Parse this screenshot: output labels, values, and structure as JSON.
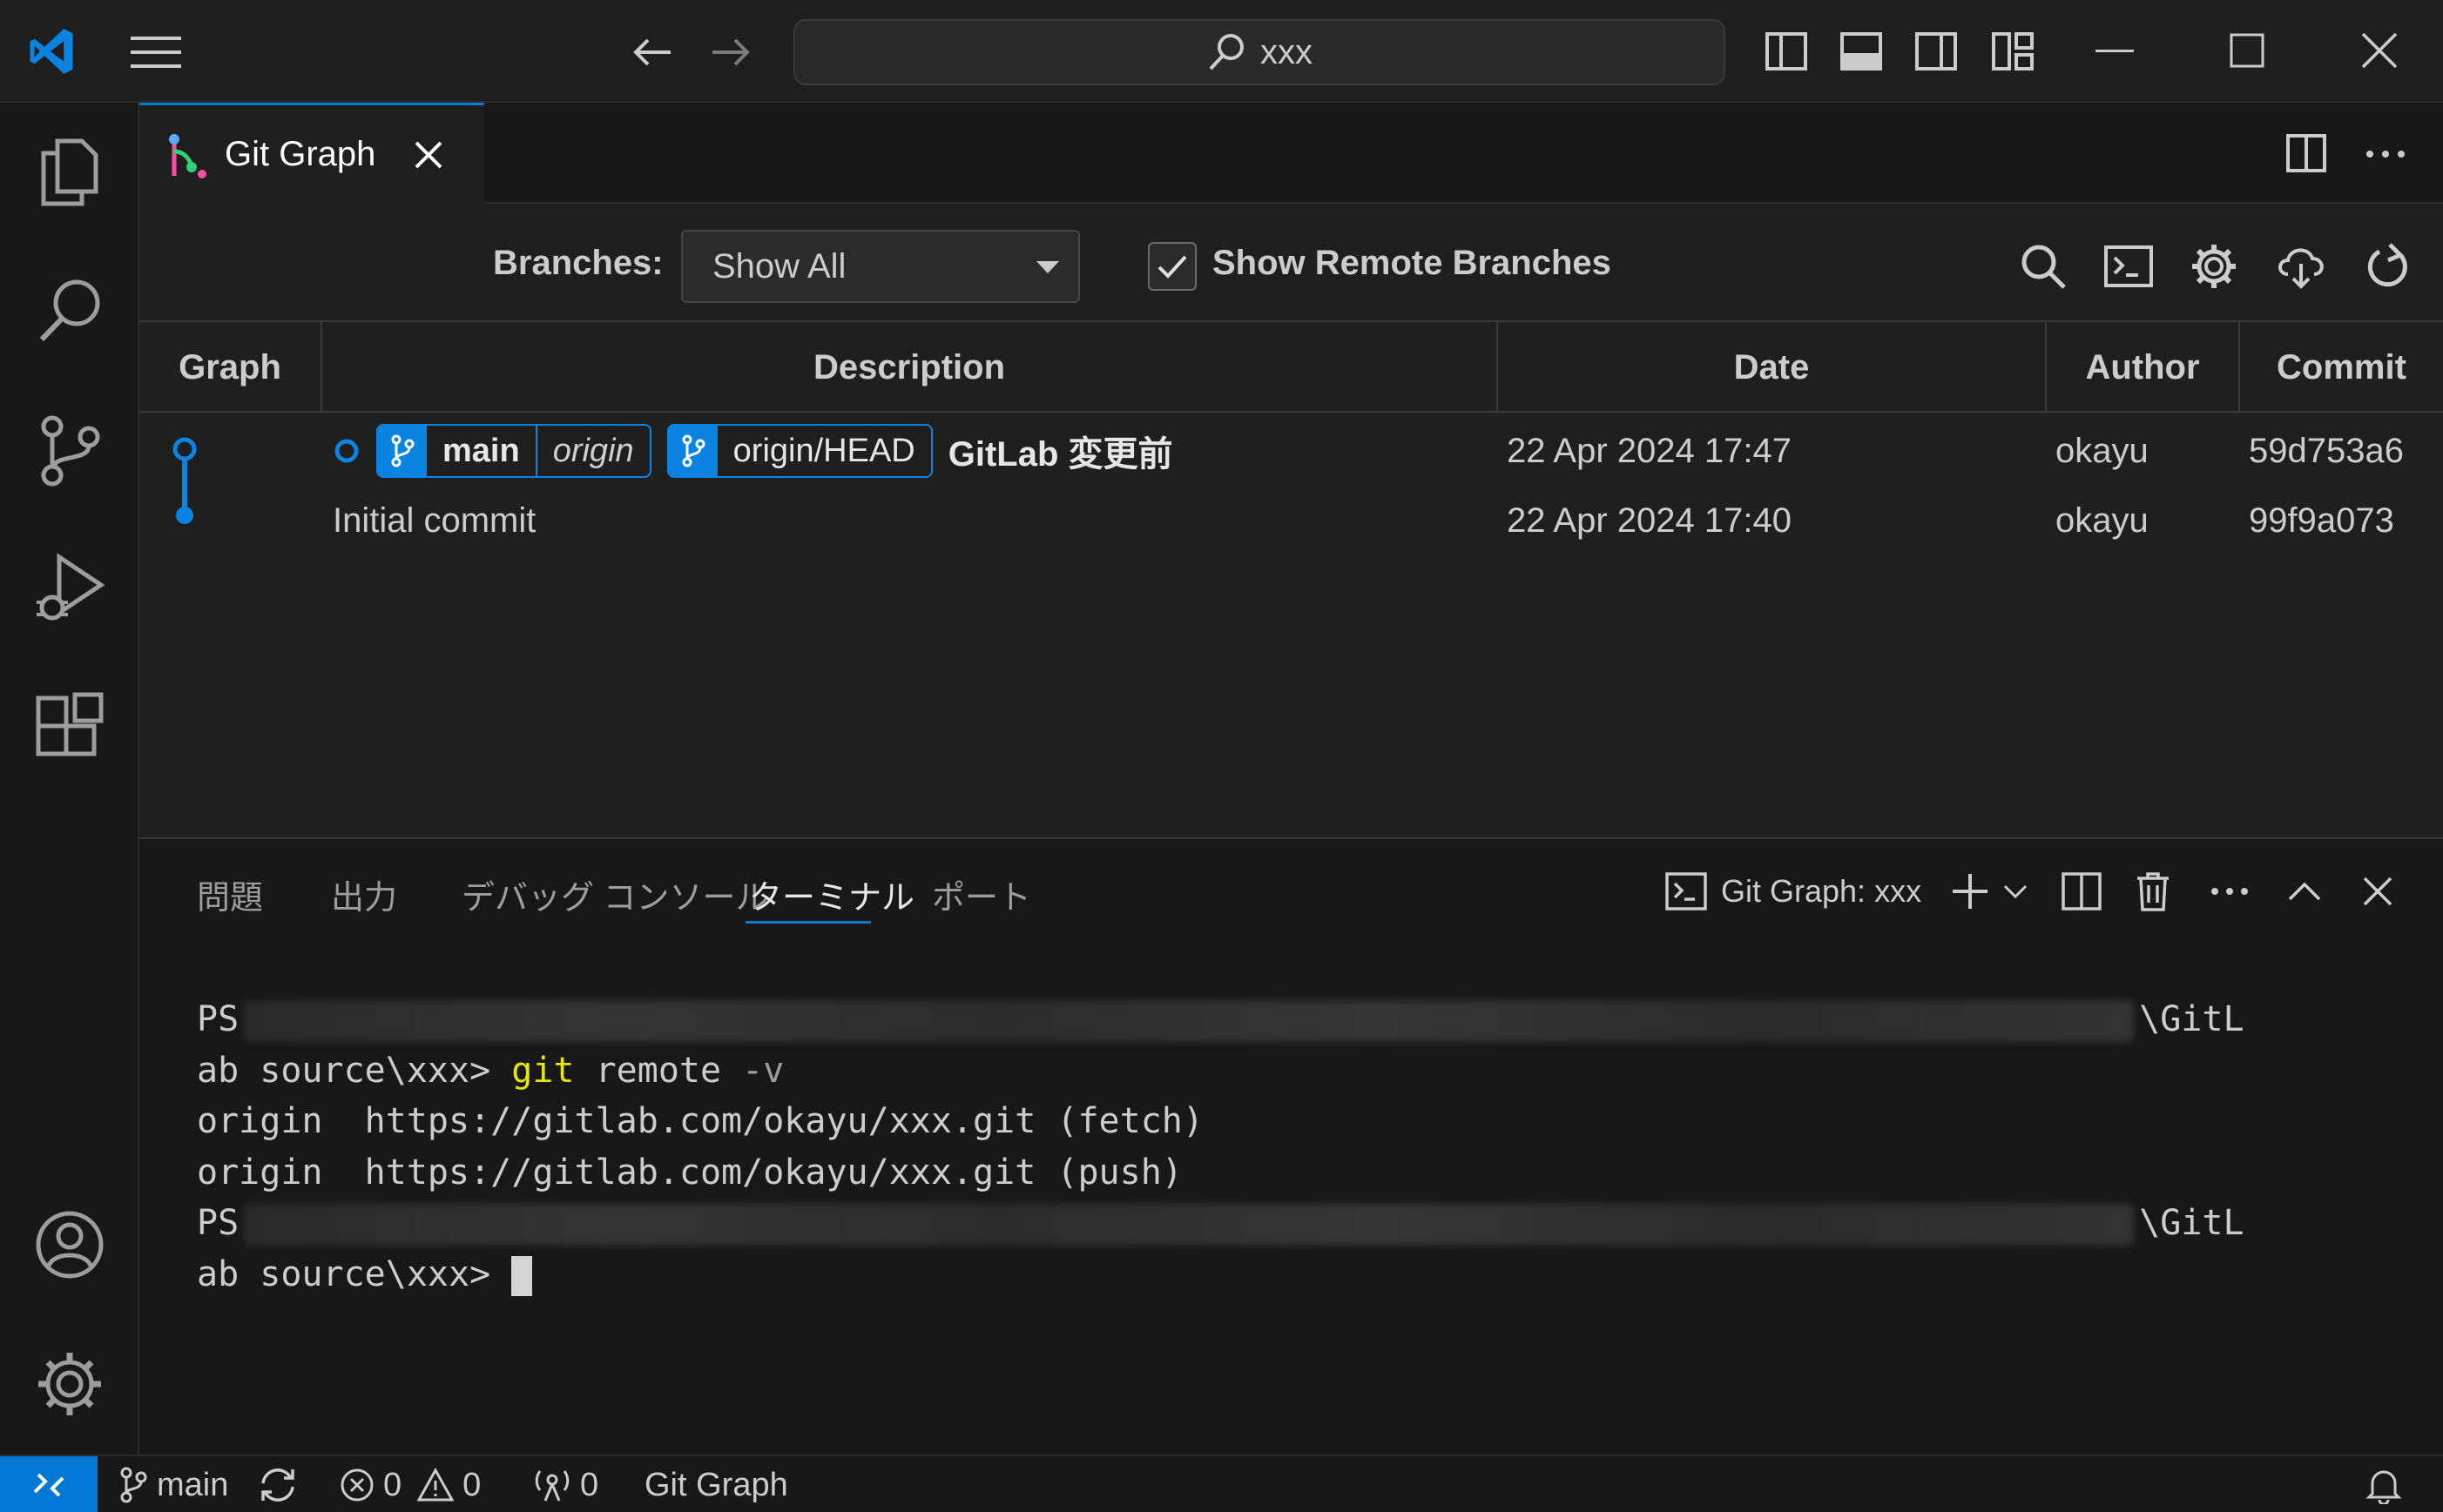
{
  "titlebar": {
    "search_text": "xxx"
  },
  "editor": {
    "tab_label": "Git Graph"
  },
  "gitgraph": {
    "branches_label": "Branches:",
    "branches_value": "Show All",
    "show_remote_label": "Show Remote Branches",
    "show_remote_checked": true,
    "columns": [
      "Graph",
      "Description",
      "Date",
      "Author",
      "Commit"
    ],
    "commits": [
      {
        "refs": [
          {
            "name": "main",
            "remote": "origin"
          },
          {
            "name": "origin/HEAD",
            "remote": ""
          }
        ],
        "message": "GitLab 変更前",
        "date": "22 Apr 2024 17:47",
        "author": "okayu",
        "hash": "59d753a6"
      },
      {
        "refs": [],
        "message": "Initial commit",
        "date": "22 Apr 2024 17:40",
        "author": "okayu",
        "hash": "99f9a073"
      }
    ],
    "graph_color": "#0a84e0"
  },
  "panel": {
    "tabs": [
      "問題",
      "出力",
      "デバッグ コンソール",
      "ターミナル",
      "ポート"
    ],
    "active_tab": "ターミナル",
    "terminal_name": "Git Graph: xxx",
    "terminal": {
      "l1_prefix": "PS",
      "l1_suffix": "\\GitL",
      "l2_prompt": "ab source\\xxx> ",
      "l2_cmd": "git",
      "l2_args": " remote ",
      "l2_flag": "-v",
      "l3": "origin  https://gitlab.com/okayu/xxx.git (fetch)",
      "l4": "origin  https://gitlab.com/okayu/xxx.git (push)",
      "l5_prefix": "PS",
      "l5_suffix": "\\GitL",
      "l6_prompt": "ab source\\xxx> "
    }
  },
  "statusbar": {
    "branch": "main",
    "errors": "0",
    "warnings": "0",
    "ports": "0",
    "extension": "Git Graph"
  },
  "colors": {
    "accent": "#0078d4",
    "ref_blue": "#0a84e0",
    "terminal_yellow": "#e5e510"
  }
}
